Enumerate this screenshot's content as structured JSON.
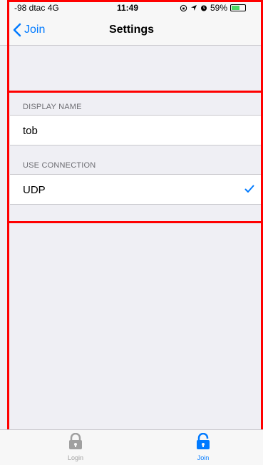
{
  "status_bar": {
    "carrier": "-98 dtac  4G",
    "time": "11:49",
    "battery": "59%",
    "battery_level": 0.59
  },
  "nav": {
    "back_label": "Join",
    "title": "Settings"
  },
  "sections": [
    {
      "header": "DISPLAY NAME",
      "value": "tob"
    },
    {
      "header": "USE CONNECTION",
      "value": "UDP",
      "selected": true
    }
  ],
  "tab_bar": {
    "tabs": [
      {
        "label": "Login",
        "icon": "lock-icon",
        "active": false
      },
      {
        "label": "Join",
        "icon": "unlock-icon",
        "active": true
      }
    ]
  },
  "colors": {
    "accent": "#007aff",
    "highlight_frame": "#ff0000",
    "background": "#efeff4"
  }
}
